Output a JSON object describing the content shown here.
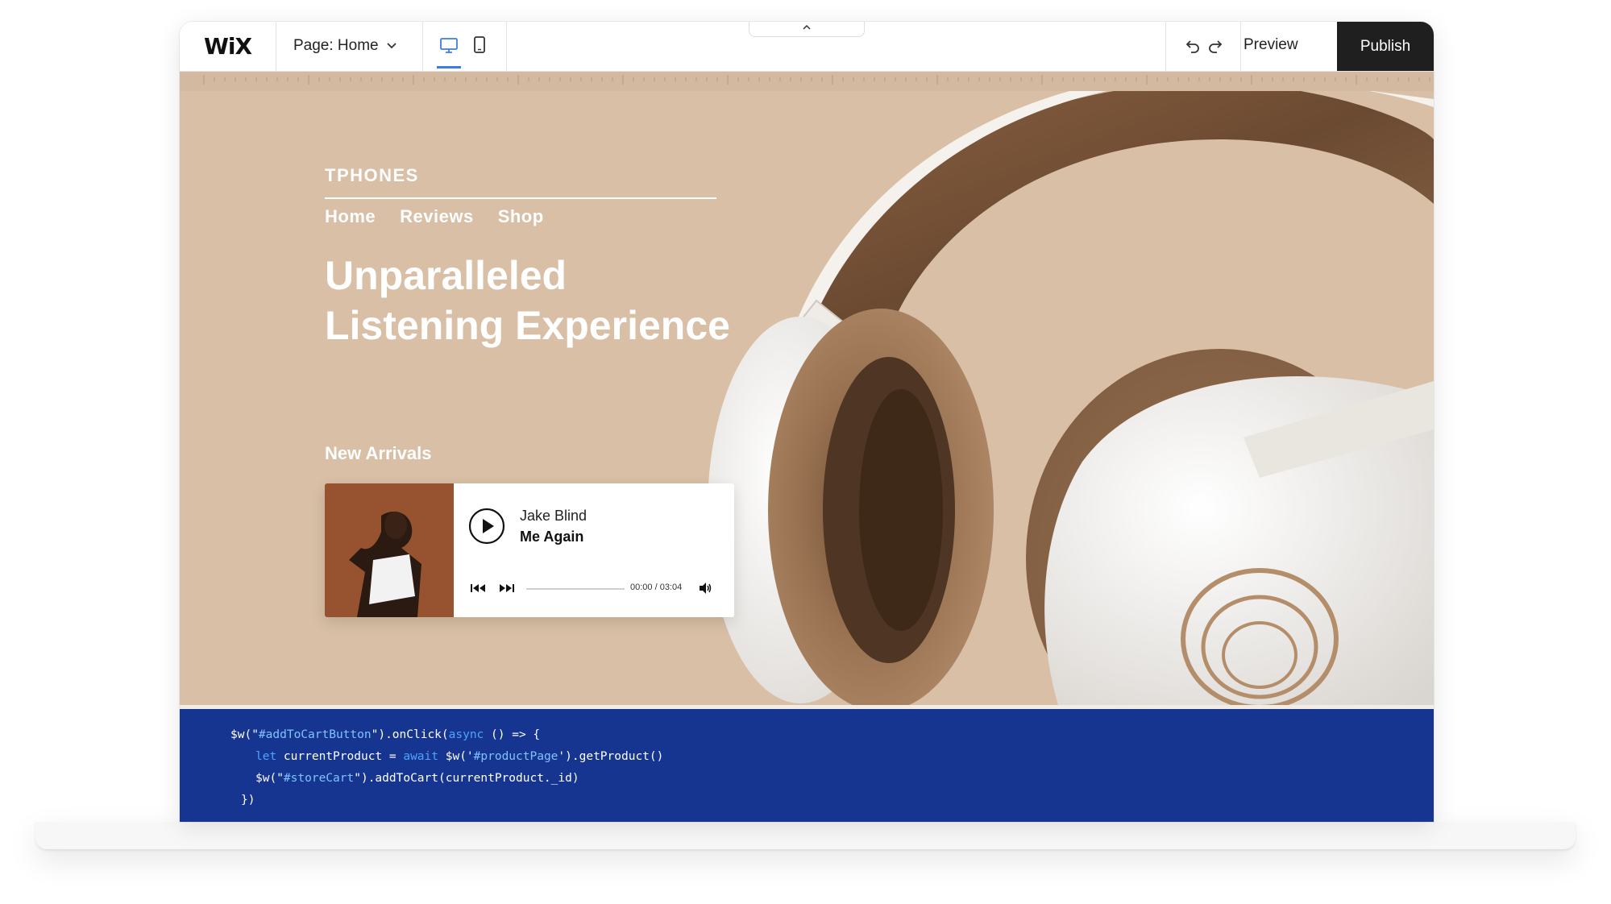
{
  "editor": {
    "logo": "WiX",
    "page_selector": "Page: Home",
    "device_desktop_icon": "desktop-icon",
    "device_mobile_icon": "mobile-icon",
    "collapse_icon": "chevron-up-icon",
    "undo_icon": "undo-icon",
    "redo_icon": "redo-icon",
    "preview_label": "Preview",
    "publish_label": "Publish",
    "accent_color": "#3b7de0",
    "publish_bg": "#1f1f1f"
  },
  "site": {
    "brand": "TPHONES",
    "nav": [
      "Home",
      "Reviews",
      "Shop"
    ],
    "headline_line1": "Unparalleled",
    "headline_line2": "Listening Experience",
    "section_title": "New Arrivals",
    "hero_bg": "#d8bfa5",
    "player": {
      "artist": "Jake Blind",
      "song": "Me Again",
      "time": "00:00 / 03:04",
      "progress": 0.0,
      "play_icon": "play-icon",
      "prev_icon": "previous-icon",
      "next_icon": "next-icon",
      "volume_icon": "volume-icon"
    }
  },
  "code": {
    "bg": "#163590",
    "line1_a": "$w(\"",
    "line1_b": "#addToCartButton",
    "line1_c": "\").onClick(",
    "line1_d": "async",
    "line1_e": " () => {",
    "line2_a": "let",
    "line2_b": " currentProduct = ",
    "line2_c": "await",
    "line2_d": " $w('",
    "line2_e": "#productPage",
    "line2_f": "').getProduct()",
    "line3_a": "$w(\"",
    "line3_b": "#storeCart",
    "line3_c": "\").addToCart(currentProduct._id)",
    "line4": "})"
  }
}
